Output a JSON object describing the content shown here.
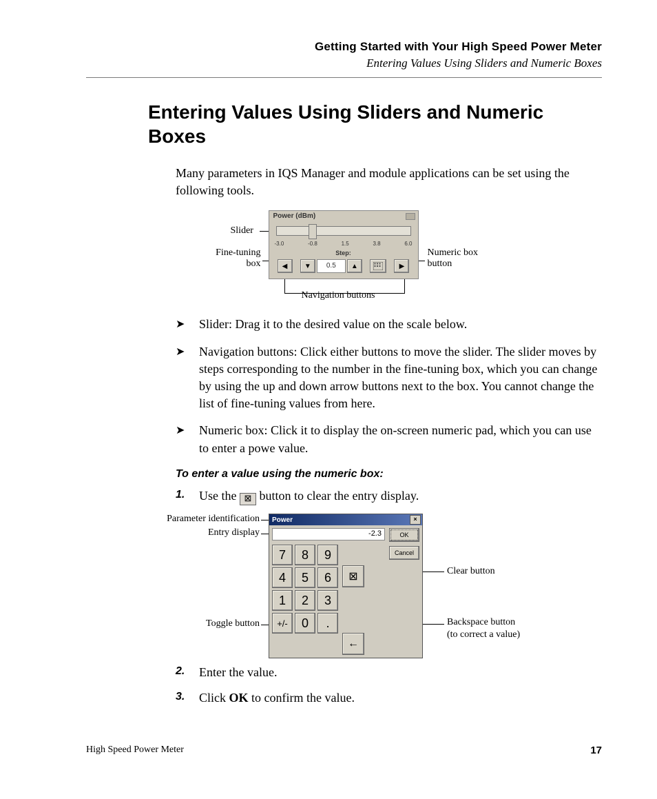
{
  "header": {
    "chapter": "Getting Started with Your High Speed Power Meter",
    "section": "Entering Values Using Sliders and Numeric Boxes"
  },
  "title": "Entering Values Using Sliders and Numeric Boxes",
  "intro": "Many parameters in IQS Manager and module applications can be set using the following tools.",
  "slider_figure": {
    "panel_title": "Power (dBm)",
    "ticks": [
      "-3.0",
      "-0.8",
      "1.5",
      "3.8",
      "6.0"
    ],
    "step_label": "Step:",
    "step_value": "0.5",
    "callouts": {
      "slider": "Slider",
      "fine_tuning": "Fine-tuning box",
      "numeric_box_btn": "Numeric box button",
      "nav": "Navigation buttons"
    }
  },
  "bullets": {
    "slider": "Slider: Drag it to the desired value on the scale below.",
    "nav": "Navigation buttons: Click either buttons to move the slider. The slider moves by steps corresponding to the number in the fine-tuning box, which you can change by using the up and down arrow buttons next to the box. You cannot change the list of fine-tuning values from here.",
    "numeric": "Numeric box: Click it to display the on-screen numeric pad, which you can use to enter a powe value."
  },
  "procedure": {
    "heading": "To enter a value using the numeric box:",
    "step1_before": "Use the ",
    "step1_after": " button to clear the entry display.",
    "step2": "Enter the value.",
    "step3_before": "Click ",
    "step3_bold": "OK",
    "step3_after": " to confirm the value."
  },
  "keypad_figure": {
    "title": "Power",
    "display": "-2.3",
    "ok": "OK",
    "cancel": "Cancel",
    "keys": {
      "r1": [
        "7",
        "8",
        "9"
      ],
      "r2": [
        "4",
        "5",
        "6"
      ],
      "r3": [
        "1",
        "2",
        "3"
      ],
      "r4": [
        "+/-",
        "0",
        "."
      ]
    },
    "clear_sym": "⊠",
    "backspace_sym": "←",
    "callouts": {
      "param_id": "Parameter identification",
      "entry_display": "Entry display",
      "toggle": "Toggle button",
      "clear": "Clear button",
      "backspace_l1": "Backspace button",
      "backspace_l2": "(to correct a value)"
    }
  },
  "footer": {
    "doc_title": "High Speed Power Meter",
    "page": "17"
  }
}
